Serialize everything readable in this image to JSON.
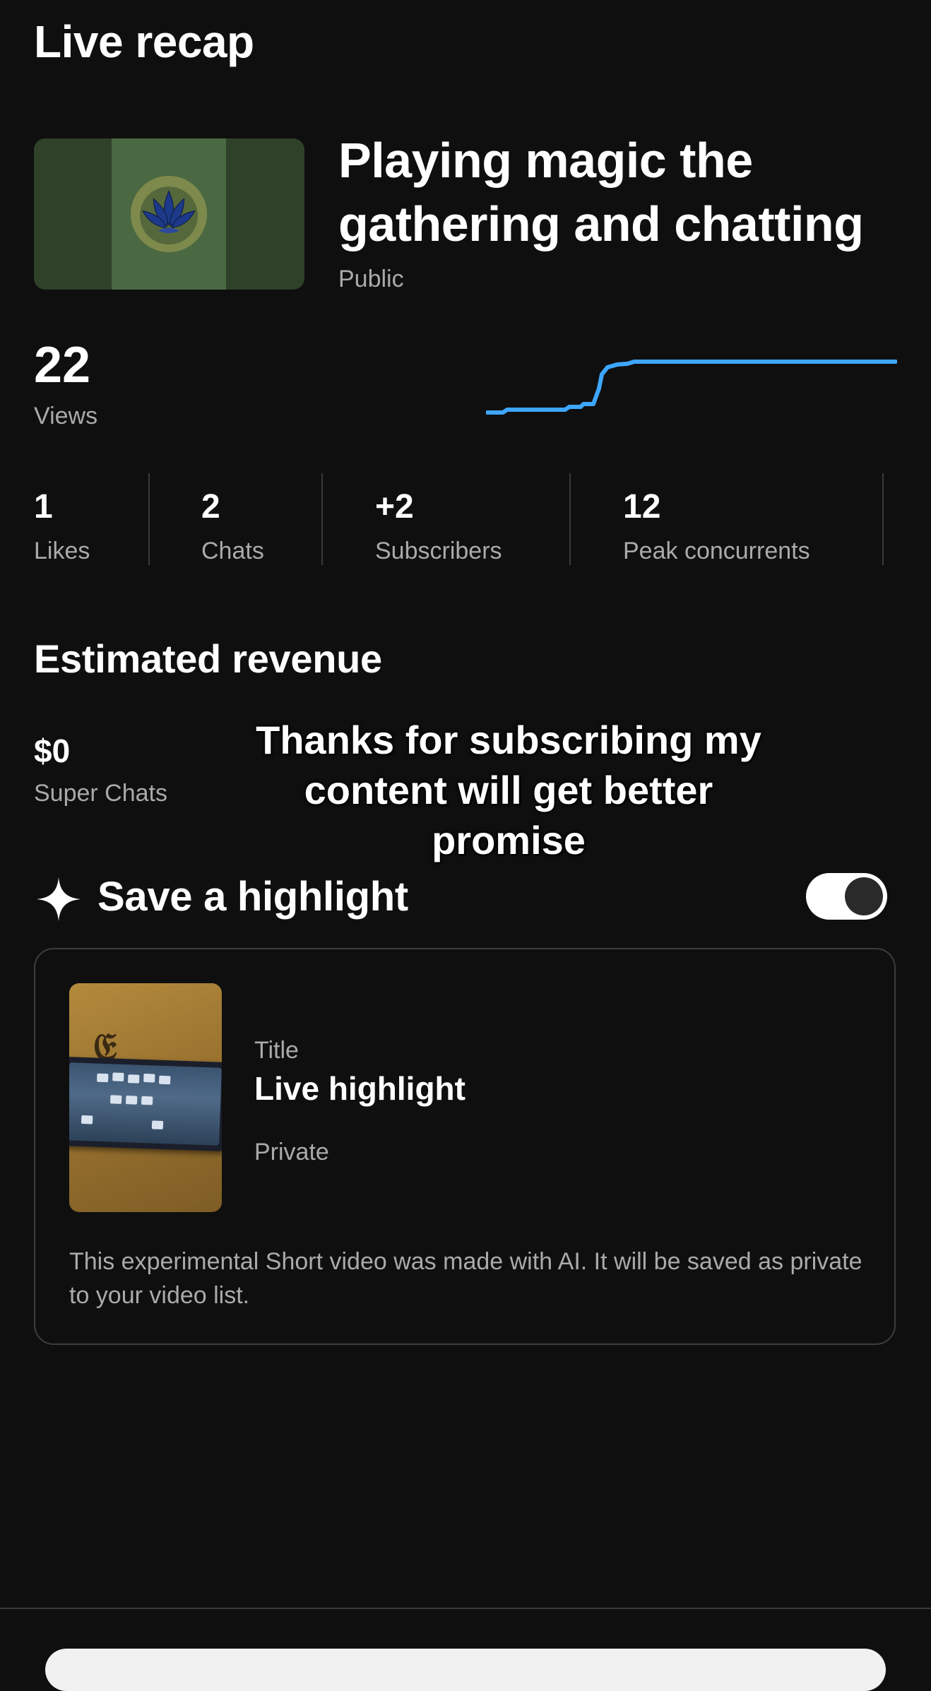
{
  "header": {
    "title": "Live recap"
  },
  "stream": {
    "title": "Playing magic the gathering and chatting",
    "visibility": "Public"
  },
  "views": {
    "count": "22",
    "label": "Views"
  },
  "stats": [
    {
      "value": "1",
      "label": "Likes"
    },
    {
      "value": "2",
      "label": "Chats"
    },
    {
      "value": "+2",
      "label": "Subscribers"
    },
    {
      "value": "12",
      "label": "Peak concurrents"
    }
  ],
  "revenue": {
    "title": "Estimated revenue",
    "value": "$0",
    "label": "Super Chats"
  },
  "overlay_caption": "Thanks for subscribing my content will get better promise",
  "highlight": {
    "title": "Save a highlight",
    "toggle_on": true,
    "card": {
      "title_label": "Title",
      "title": "Live highlight",
      "privacy": "Private",
      "note": "This experimental Short video was made with AI. It will be saved as private to your video list."
    }
  },
  "colors": {
    "background": "#0f0f0f",
    "accent_line": "#3ea6ff",
    "secondary_text": "#aaaaaa"
  },
  "icons": [
    "sparkle-icon",
    "toggle-switch"
  ]
}
